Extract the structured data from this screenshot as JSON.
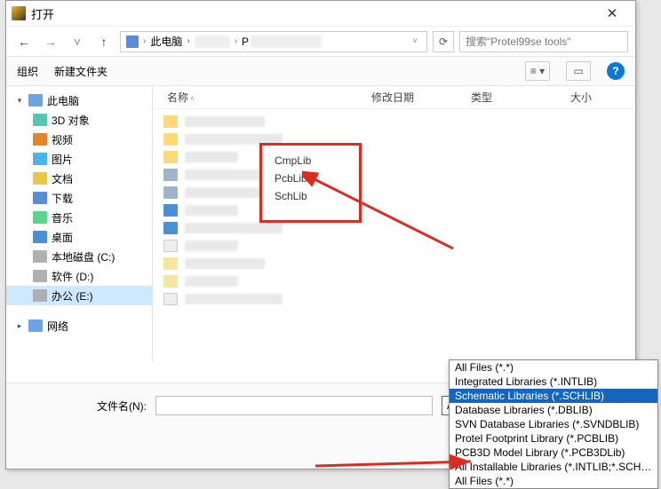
{
  "title": "打开",
  "nav": {
    "breadcrumb_main": "此电脑",
    "search_placeholder": "搜索\"Protel99se tools\""
  },
  "toolbar": {
    "organize": "组织",
    "new_folder": "新建文件夹"
  },
  "sidebar": {
    "items": [
      {
        "label": "此电脑",
        "icon": "ico-pc",
        "expanded": true,
        "level": 0
      },
      {
        "label": "3D 对象",
        "icon": "ico-3d",
        "level": 1
      },
      {
        "label": "视频",
        "icon": "ico-video",
        "level": 1
      },
      {
        "label": "图片",
        "icon": "ico-pics",
        "level": 1
      },
      {
        "label": "文档",
        "icon": "ico-docs",
        "level": 1
      },
      {
        "label": "下载",
        "icon": "ico-dl",
        "level": 1
      },
      {
        "label": "音乐",
        "icon": "ico-music",
        "level": 1
      },
      {
        "label": "桌面",
        "icon": "ico-desktop",
        "level": 1
      },
      {
        "label": "本地磁盘 (C:)",
        "icon": "ico-drive",
        "level": 1
      },
      {
        "label": "软件 (D:)",
        "icon": "ico-drive",
        "level": 1
      },
      {
        "label": "办公 (E:)",
        "icon": "ico-drive",
        "level": 1,
        "selected": true
      },
      {
        "label": "网络",
        "icon": "ico-net",
        "level": 0,
        "gap": true
      }
    ]
  },
  "columns": {
    "name": "名称",
    "date": "修改日期",
    "type": "类型",
    "size": "大小"
  },
  "redbox": {
    "l1": "CmpLib",
    "l2": "PcbLib",
    "l3": "SchLib"
  },
  "footer": {
    "filename_label": "文件名(N):",
    "current_filter": "All Files (*.*)"
  },
  "dropdown_options": [
    {
      "label": "All Files (*.*)"
    },
    {
      "label": "Integrated Libraries (*.INTLIB)"
    },
    {
      "label": "Schematic Libraries (*.SCHLIB)",
      "selected": true
    },
    {
      "label": "Database Libraries (*.DBLIB)"
    },
    {
      "label": "SVN Database Libraries (*.SVNDBLIB)"
    },
    {
      "label": "Protel Footprint Library (*.PCBLIB)"
    },
    {
      "label": "PCB3D Model Library (*.PCB3DLib)"
    },
    {
      "label": "All Installable Libraries (*.INTLIB;*.SCHLIB)"
    },
    {
      "label": "All Files (*.*)"
    }
  ]
}
